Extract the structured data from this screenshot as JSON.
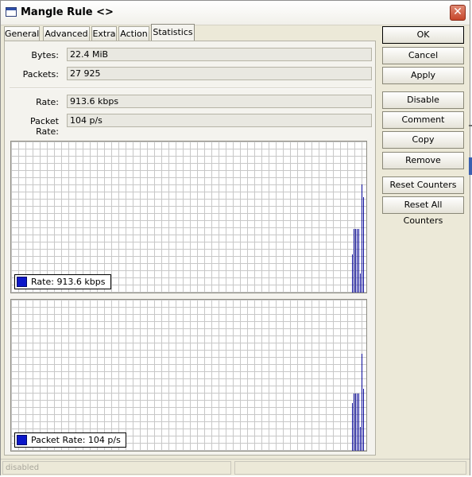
{
  "window": {
    "title": "Mangle Rule <>",
    "close_symbol": "✕"
  },
  "tabs": [
    {
      "label": "General"
    },
    {
      "label": "Advanced"
    },
    {
      "label": "Extra"
    },
    {
      "label": "Action"
    },
    {
      "label": "Statistics"
    }
  ],
  "active_tab": "Statistics",
  "fields": {
    "bytes": {
      "label": "Bytes:",
      "value": "22.4 MiB"
    },
    "packets": {
      "label": "Packets:",
      "value": "27 925"
    },
    "rate": {
      "label": "Rate:",
      "value": "913.6 kbps"
    },
    "packet_rate": {
      "label": "Packet Rate:",
      "value": "104 p/s"
    }
  },
  "graphs": {
    "rate": {
      "legend_label": "Rate:",
      "legend_value": "913.6 kbps",
      "color": "#0b17c9"
    },
    "packet_rate": {
      "legend_label": "Packet Rate:",
      "legend_value": "104 p/s",
      "color": "#0b17c9"
    }
  },
  "buttons": {
    "ok": "OK",
    "cancel": "Cancel",
    "apply": "Apply",
    "disable": "Disable",
    "comment": "Comment",
    "copy": "Copy",
    "remove": "Remove",
    "reset_counters": "Reset Counters",
    "reset_all_counters": "Reset All Counters"
  },
  "status": {
    "state": "disabled",
    "info": ""
  }
}
